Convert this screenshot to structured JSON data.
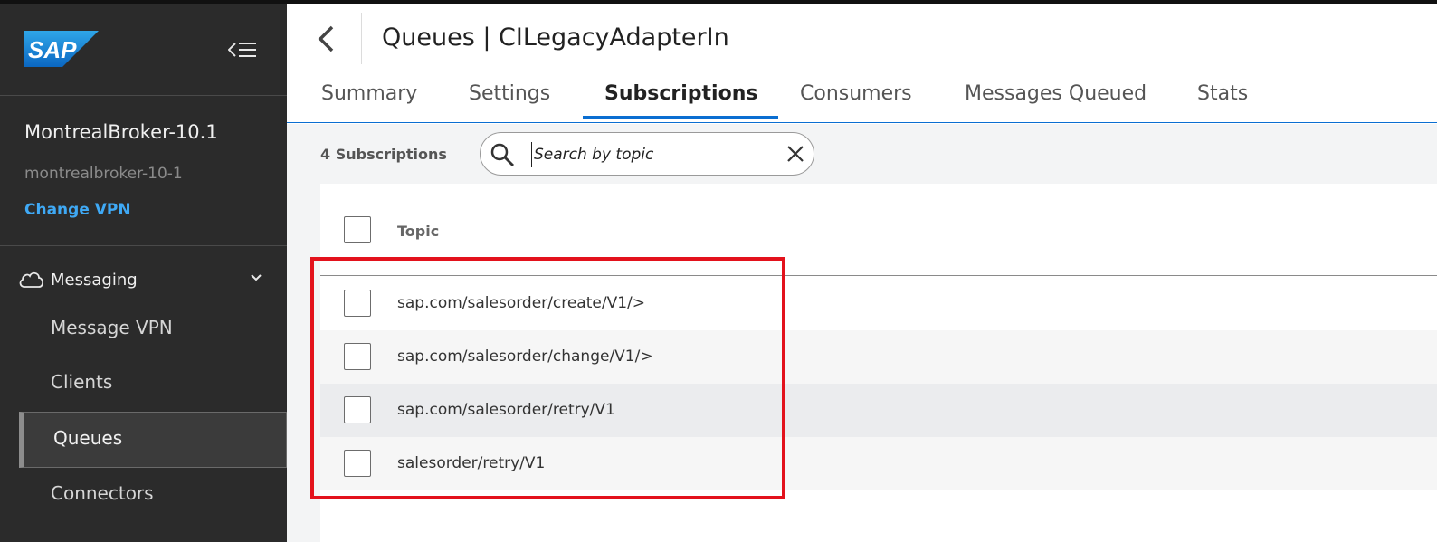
{
  "sidebar": {
    "logo_text": "SAP",
    "broker_name": "MontrealBroker-10.1",
    "broker_id": "montrealbroker-10-1",
    "change_vpn": "Change VPN",
    "group_label": "Messaging",
    "items": [
      {
        "label": "Message VPN"
      },
      {
        "label": "Clients"
      },
      {
        "label": "Queues",
        "active": true
      },
      {
        "label": "Connectors"
      }
    ]
  },
  "header": {
    "title": "Queues | CILegacyAdapterIn"
  },
  "tabs": [
    {
      "label": "Summary"
    },
    {
      "label": "Settings"
    },
    {
      "label": "Subscriptions",
      "active": true
    },
    {
      "label": "Consumers"
    },
    {
      "label": "Messages Queued"
    },
    {
      "label": "Stats"
    }
  ],
  "toolbar": {
    "count_label": "4 Subscriptions",
    "search_placeholder": "Search by topic"
  },
  "table": {
    "column_topic": "Topic",
    "rows": [
      {
        "topic": "sap.com/salesorder/create/V1/>"
      },
      {
        "topic": "sap.com/salesorder/change/V1/>"
      },
      {
        "topic": "sap.com/salesorder/retry/V1"
      },
      {
        "topic": "salesorder/retry/V1"
      }
    ]
  },
  "colors": {
    "accent": "#0a6ed1",
    "link": "#3fa9f5",
    "highlight": "#e3121c",
    "sidebar_bg": "#2b2b2b"
  }
}
